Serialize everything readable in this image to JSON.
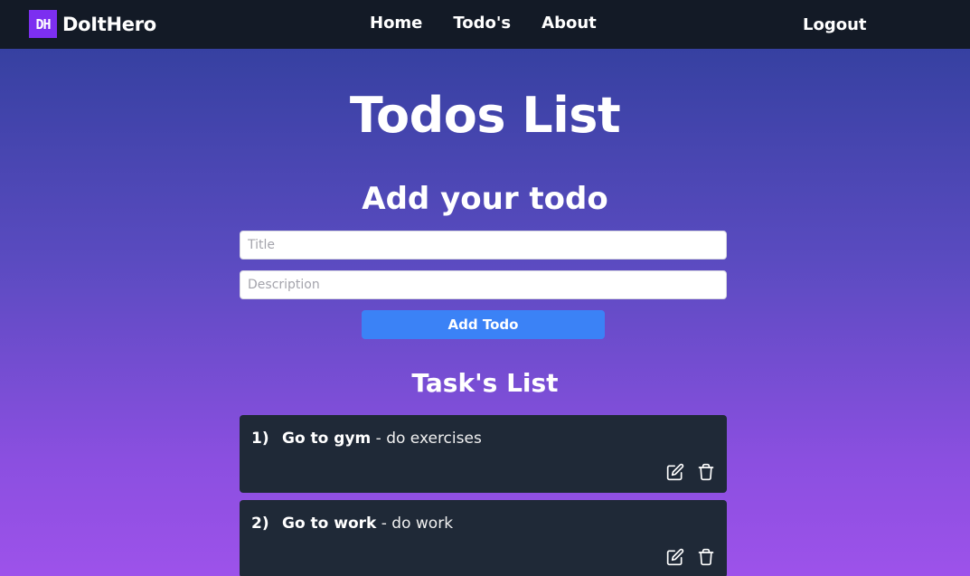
{
  "nav": {
    "logo_text": "DH",
    "brand": "DoItHero",
    "links": [
      "Home",
      "Todo's",
      "About"
    ],
    "logout": "Logout"
  },
  "page": {
    "title": "Todos List",
    "form_title": "Add your todo",
    "title_placeholder": "Title",
    "description_placeholder": "Description",
    "add_button": "Add Todo",
    "tasks_title": "Task's List"
  },
  "tasks": [
    {
      "num": "1)",
      "title": "Go to gym",
      "desc": " - do exercises"
    },
    {
      "num": "2)",
      "title": "Go to work",
      "desc": " - do work"
    }
  ],
  "icons": {
    "edit": "edit-icon",
    "delete": "trash-icon"
  },
  "colors": {
    "nav_bg": "#131a26",
    "logo_bg": "#7c2ff0",
    "button": "#3b82f6",
    "card_bg": "#1f2937",
    "gradient_top": "#2e3e9a",
    "gradient_bottom": "#9d52ea"
  }
}
